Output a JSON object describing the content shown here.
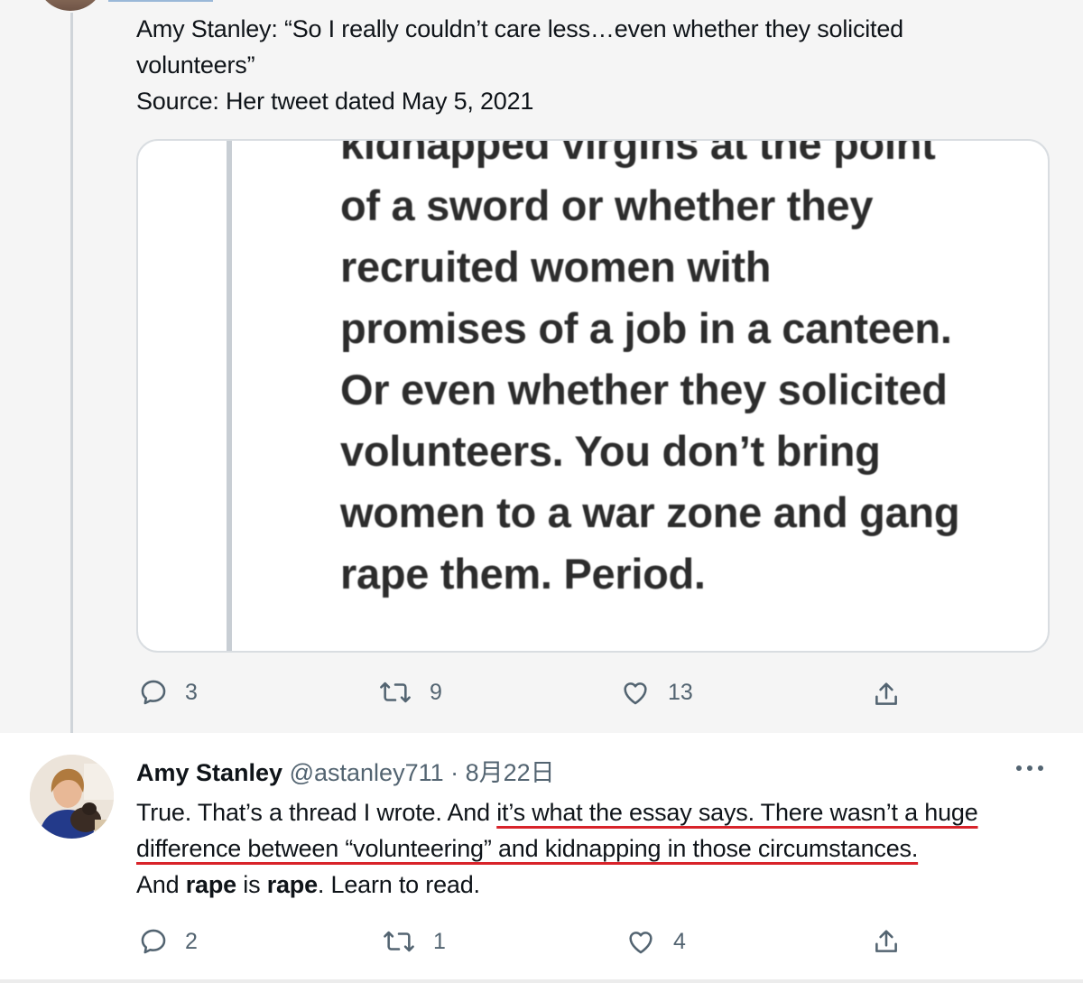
{
  "tweet1": {
    "text_lines": [
      "Amy Stanley: “So I really couldn’t care less…even whether they solicited",
      "volunteers”",
      "Source: Her tweet dated May 5, 2021"
    ],
    "quote_image_lines": [
      "kidnapped virgins at the point",
      "of a sword or whether they",
      "recruited women with",
      "promises of a job in a canteen.",
      "Or even whether they solicited",
      "volunteers. You don’t bring",
      "women to a war zone and gang",
      "rape them. Period."
    ],
    "actions": {
      "replies": "3",
      "retweets": "9",
      "likes": "13"
    }
  },
  "tweet2": {
    "name": "Amy Stanley",
    "handle_date": "@astanley711 · 8月22日",
    "body": {
      "line1_a": "True. That’s a thread I wrote. And ",
      "line1_b": "it’s what the essay says. There wasn’t a huge",
      "line2": "difference between “volunteering” and kidnapping in those circumstances.",
      "line3_a": "And ",
      "line3_b": "rape",
      "line3_c": " is ",
      "line3_d": "rape",
      "line3_e": ". Learn to read."
    },
    "actions": {
      "replies": "2",
      "retweets": "1",
      "likes": "4"
    }
  },
  "colors": {
    "underline": "#d8232a",
    "icon_gray": "#536471",
    "card_border": "#d9dde1"
  }
}
